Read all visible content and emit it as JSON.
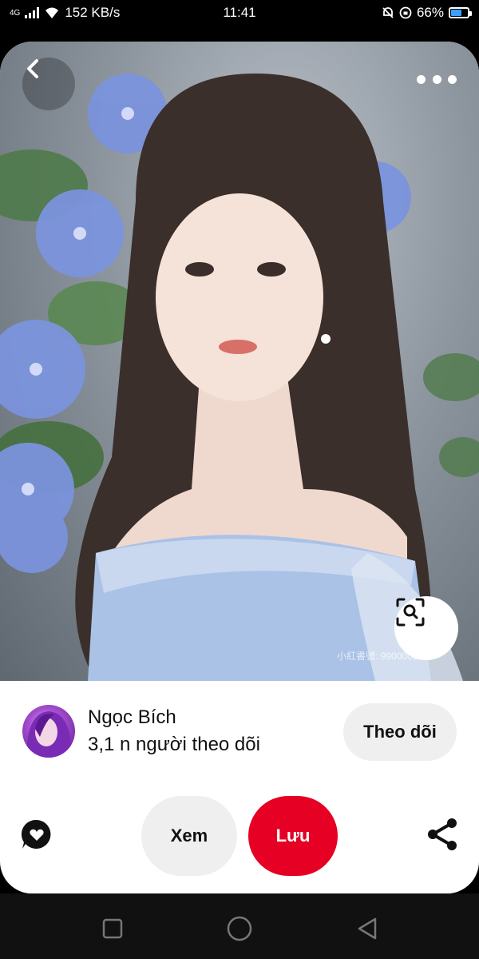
{
  "status_bar": {
    "network": "4G",
    "speed": "152 KB/s",
    "time": "11:41",
    "battery": "66%",
    "battery_level": 0.66
  },
  "pin": {
    "watermark": "小紅書號: 990000218",
    "back_icon": "chevron-left-icon",
    "more_icon": "more-horizontal-icon",
    "lens_icon": "visual-search-icon"
  },
  "creator": {
    "name": "Ngọc Bích",
    "followers": "3,1 n người theo dõi",
    "follow_label": "Theo dõi"
  },
  "actions": {
    "view_label": "Xem",
    "save_label": "Lưu",
    "comment_icon": "comment-heart-icon",
    "share_icon": "share-icon"
  },
  "colors": {
    "save_button": "#e60023",
    "neutral_button": "#efefef"
  },
  "nav": {
    "recent_icon": "square-icon",
    "home_icon": "circle-icon",
    "back_icon": "triangle-back-icon"
  }
}
